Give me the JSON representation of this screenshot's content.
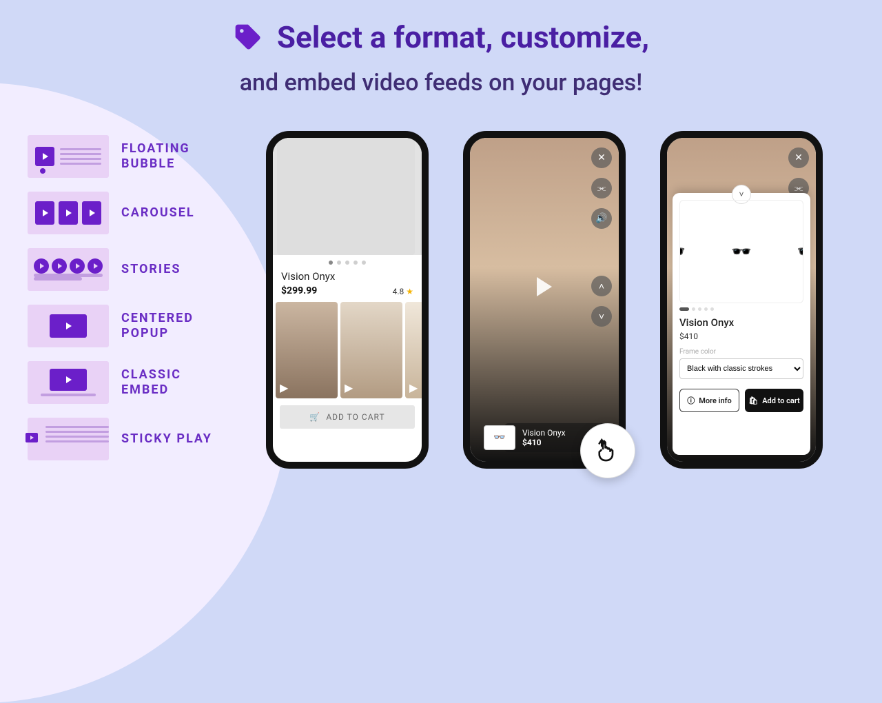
{
  "hero": {
    "title": "Select a format, customize,",
    "subtitle": "and embed video feeds on your pages!"
  },
  "formats": [
    {
      "key": "bubble",
      "label": "FLOATING BUBBLE"
    },
    {
      "key": "carousel",
      "label": "CAROUSEL"
    },
    {
      "key": "stories",
      "label": "STORIES"
    },
    {
      "key": "centered",
      "label": "CENTERED POPUP"
    },
    {
      "key": "embed",
      "label": "CLASSIC EMBED"
    },
    {
      "key": "sticky",
      "label": "STICKY PLAY"
    }
  ],
  "phone1": {
    "title": "Vision Onyx",
    "price": "$299.99",
    "rating": "4.8",
    "cta": "ADD TO CART"
  },
  "phone2": {
    "product": "Vision Onyx",
    "price": "$410"
  },
  "phone3": {
    "title": "Vision Onyx",
    "price": "$410",
    "variant_label": "Frame color",
    "variant_value": "Black with classic strokes",
    "more": "More info",
    "add": "Add to cart"
  }
}
